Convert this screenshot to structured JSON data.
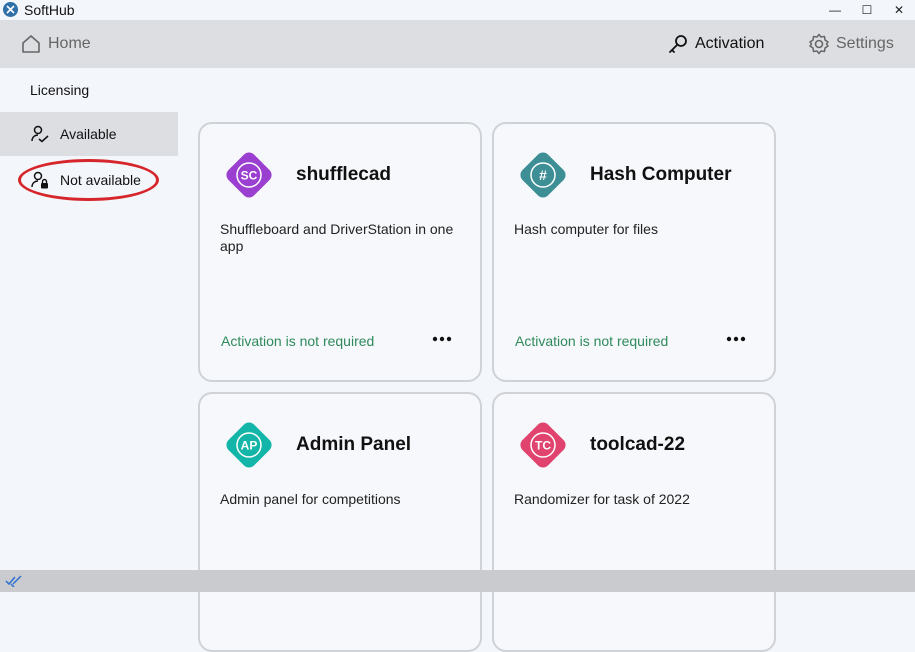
{
  "window": {
    "title": "SoftHub",
    "minimize": "—",
    "maximize": "☐",
    "close": "✕"
  },
  "nav": {
    "home": "Home",
    "activation": "Activation",
    "settings": "Settings"
  },
  "sidebar": {
    "header": "Licensing",
    "items": [
      {
        "label": "Available",
        "active": true
      },
      {
        "label": "Not available",
        "active": false
      }
    ]
  },
  "cards": [
    {
      "initials": "SC",
      "title": "shufflecad",
      "description": "Shuffleboard and DriverStation in one app",
      "status": "Activation is not required",
      "color": "#9b3fd0"
    },
    {
      "initials": "#",
      "title": "Hash Computer",
      "description": "Hash computer for files",
      "status": "Activation is not required",
      "color": "#3e8e95"
    },
    {
      "initials": "AP",
      "title": "Admin Panel",
      "description": "Admin panel for competitions",
      "status": "",
      "color": "#12b5a8"
    },
    {
      "initials": "TC",
      "title": "toolcad-22",
      "description": "Randomizer for task of 2022",
      "status": "",
      "color": "#e0446e"
    }
  ],
  "colors": {
    "status_green": "#2f8a5c",
    "highlight_ellipse": "#d7262b"
  }
}
